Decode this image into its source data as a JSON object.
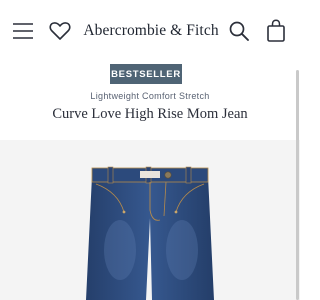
{
  "header": {
    "brand": "Abercrombie & Fitch",
    "icons": [
      "menu-icon",
      "heart-icon",
      "search-icon",
      "shopping-bag-icon"
    ]
  },
  "product": {
    "badge": "BESTSELLER",
    "subtitle": "Lightweight Comfort Stretch",
    "title": "Curve Love High Rise Mom Jean"
  },
  "colors": {
    "badge_bg": "#4f6475",
    "denim": "#2f4f83",
    "image_bg": "#f4f4f4",
    "text": "#2b2f3a"
  }
}
